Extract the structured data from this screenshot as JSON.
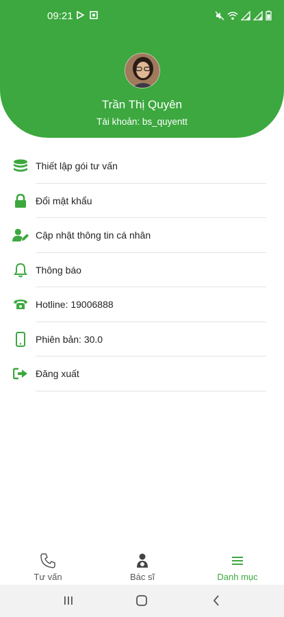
{
  "status_bar": {
    "time": "09:21"
  },
  "profile": {
    "name": "Trần Thị Quyên",
    "account": "Tài khoản: bs_quyentt"
  },
  "menu": [
    {
      "label": "Thiết lập gói tư vấn",
      "icon": "coins-icon"
    },
    {
      "label": "Đổi mật khẩu",
      "icon": "lock-icon"
    },
    {
      "label": "Cập nhật thông tin cá nhân",
      "icon": "user-edit-icon"
    },
    {
      "label": "Thông báo",
      "icon": "bell-icon"
    },
    {
      "label": "Hotline: 19006888",
      "icon": "phone-icon"
    },
    {
      "label": "Phiên bản: 30.0",
      "icon": "mobile-icon"
    },
    {
      "label": "Đăng xuất",
      "icon": "sign-out-icon"
    }
  ],
  "bottom_nav": [
    {
      "label": "Tư vấn",
      "icon": "phone-outline-icon",
      "active": false
    },
    {
      "label": "Bác sĩ",
      "icon": "doctor-icon",
      "active": false
    },
    {
      "label": "Danh mục",
      "icon": "menu-icon",
      "active": true
    }
  ],
  "colors": {
    "primary": "#3ca83f",
    "text": "#222222",
    "divider": "#e4e4e4"
  }
}
